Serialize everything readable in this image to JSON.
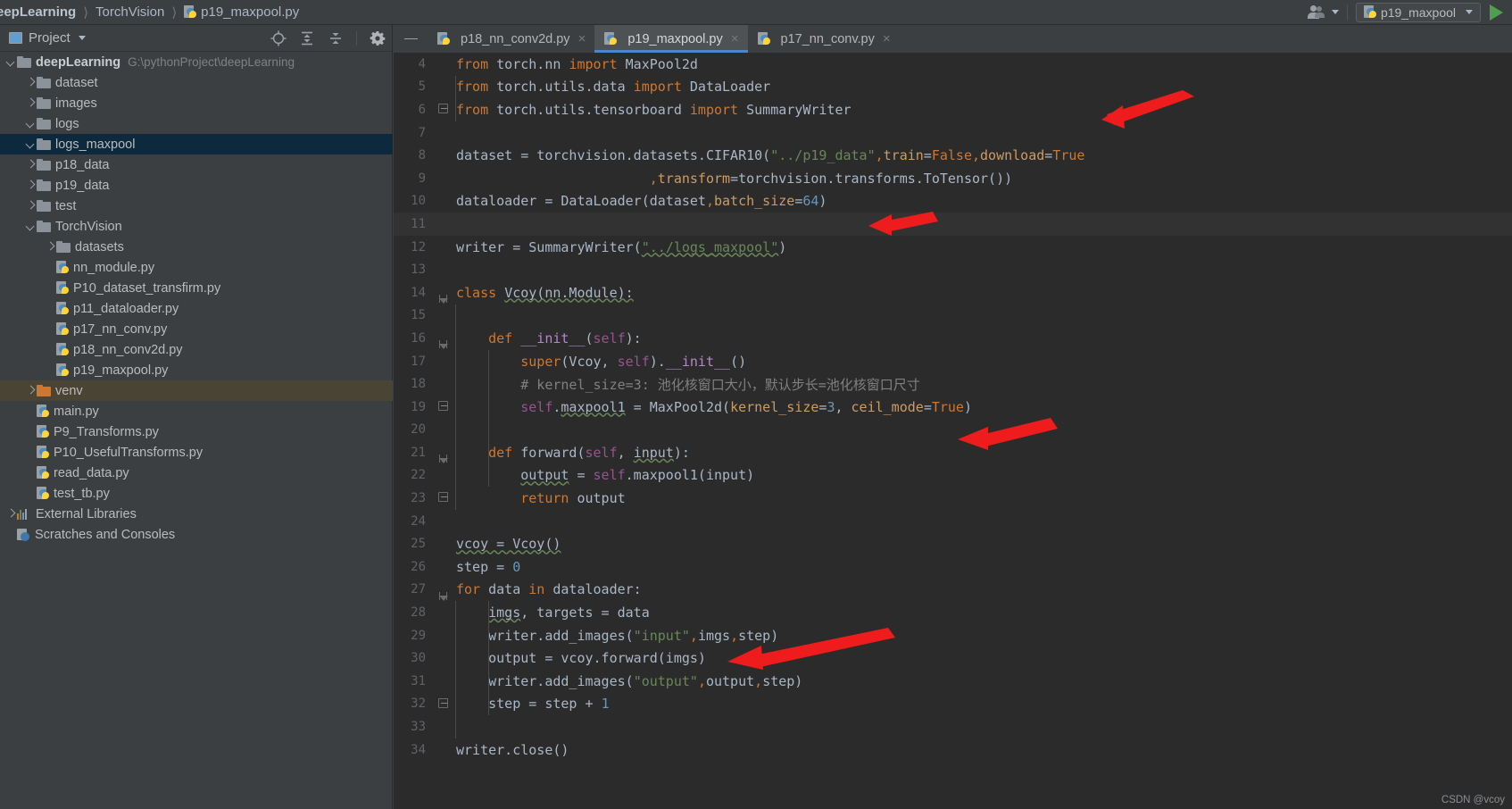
{
  "titlebar": {
    "breadcrumbs": [
      "eepLearning",
      "TorchVision",
      "p19_maxpool.py"
    ],
    "account_icon": "people-icon",
    "run_config": "p19_maxpool",
    "run_icon": "run-triangle-icon"
  },
  "project_panel": {
    "title": "Project",
    "tools": [
      "locate-target-icon",
      "expand-all-icon",
      "collapse-all-icon",
      "gear-icon",
      "minimize-icon"
    ],
    "tree": [
      {
        "label": "deepLearning",
        "path": "G:\\pythonProject\\deepLearning",
        "type": "folder",
        "state": "down",
        "indent": 0,
        "bold": true,
        "selected": false
      },
      {
        "label": "dataset",
        "type": "folder",
        "state": "right",
        "indent": 1,
        "selected": false
      },
      {
        "label": "images",
        "type": "folder",
        "state": "right",
        "indent": 1,
        "selected": false
      },
      {
        "label": "logs",
        "type": "folder",
        "state": "down",
        "indent": 1,
        "selected": false
      },
      {
        "label": "logs_maxpool",
        "type": "folder",
        "state": "down",
        "indent": 1,
        "selected": true
      },
      {
        "label": "p18_data",
        "type": "folder",
        "state": "right",
        "indent": 1,
        "selected": false
      },
      {
        "label": "p19_data",
        "type": "folder",
        "state": "right",
        "indent": 1,
        "selected": false
      },
      {
        "label": "test",
        "type": "folder",
        "state": "right",
        "indent": 1,
        "selected": false
      },
      {
        "label": "TorchVision",
        "type": "folder",
        "state": "down",
        "indent": 1,
        "selected": false
      },
      {
        "label": "datasets",
        "type": "folder",
        "state": "right",
        "indent": 2,
        "selected": false
      },
      {
        "label": "nn_module.py",
        "type": "py",
        "indent": 2,
        "selected": false
      },
      {
        "label": "P10_dataset_transfirm.py",
        "type": "py",
        "indent": 2,
        "selected": false
      },
      {
        "label": "p11_dataloader.py",
        "type": "py",
        "indent": 2,
        "selected": false
      },
      {
        "label": "p17_nn_conv.py",
        "type": "py",
        "indent": 2,
        "selected": false
      },
      {
        "label": "p18_nn_conv2d.py",
        "type": "py",
        "indent": 2,
        "selected": false
      },
      {
        "label": "p19_maxpool.py",
        "type": "py",
        "indent": 2,
        "selected": false
      },
      {
        "label": "venv",
        "type": "folder-orange",
        "state": "right",
        "indent": 1,
        "selected": "venv"
      },
      {
        "label": "main.py",
        "type": "py",
        "indent": 1,
        "selected": false
      },
      {
        "label": "P9_Transforms.py",
        "type": "py",
        "indent": 1,
        "selected": false
      },
      {
        "label": "P10_UsefulTransforms.py",
        "type": "py",
        "indent": 1,
        "selected": false
      },
      {
        "label": "read_data.py",
        "type": "py",
        "indent": 1,
        "selected": false
      },
      {
        "label": "test_tb.py",
        "type": "py",
        "indent": 1,
        "selected": false
      },
      {
        "label": "External Libraries",
        "type": "library",
        "state": "right",
        "indent": 0,
        "selected": false
      },
      {
        "label": "Scratches and Consoles",
        "type": "scratch",
        "indent": 0,
        "selected": false
      }
    ]
  },
  "editor": {
    "tabs": [
      {
        "label": "p18_nn_conv2d.py",
        "active": false,
        "close": "×"
      },
      {
        "label": "p19_maxpool.py",
        "active": true,
        "close": "×"
      },
      {
        "label": "p17_nn_conv.py",
        "active": false,
        "close": "×"
      }
    ],
    "first_line_number": 4,
    "current_line": 11,
    "lines": [
      {
        "n": 4,
        "text": "from torch.nn import MaxPool2d"
      },
      {
        "n": 5,
        "text": "from torch.utils.data import DataLoader"
      },
      {
        "n": 6,
        "text": "from torch.utils.tensorboard import SummaryWriter"
      },
      {
        "n": 7,
        "text": ""
      },
      {
        "n": 8,
        "text": "dataset = torchvision.datasets.CIFAR10(\"../p19_data\",train=False,download=True"
      },
      {
        "n": 9,
        "text": "                        ,transform=torchvision.transforms.ToTensor())"
      },
      {
        "n": 10,
        "text": "dataloader = DataLoader(dataset,batch_size=64)"
      },
      {
        "n": 11,
        "text": ""
      },
      {
        "n": 12,
        "text": "writer = SummaryWriter(\"../logs_maxpool\")"
      },
      {
        "n": 13,
        "text": ""
      },
      {
        "n": 14,
        "text": "class Vcoy(nn.Module):"
      },
      {
        "n": 15,
        "text": ""
      },
      {
        "n": 16,
        "text": "    def __init__(self):"
      },
      {
        "n": 17,
        "text": "        super(Vcoy, self).__init__()"
      },
      {
        "n": 18,
        "text": "        # kernel_size=3: 池化核窗口大小，默认步长=池化核窗口尺寸"
      },
      {
        "n": 19,
        "text": "        self.maxpool1 = MaxPool2d(kernel_size=3, ceil_mode=True)"
      },
      {
        "n": 20,
        "text": ""
      },
      {
        "n": 21,
        "text": "    def forward(self, input):"
      },
      {
        "n": 22,
        "text": "        output = self.maxpool1(input)"
      },
      {
        "n": 23,
        "text": "        return output"
      },
      {
        "n": 24,
        "text": ""
      },
      {
        "n": 25,
        "text": "vcoy = Vcoy()"
      },
      {
        "n": 26,
        "text": "step = 0"
      },
      {
        "n": 27,
        "text": "for data in dataloader:"
      },
      {
        "n": 28,
        "text": "    imgs, targets = data"
      },
      {
        "n": 29,
        "text": "    writer.add_images(\"input\",imgs,step)"
      },
      {
        "n": 30,
        "text": "    output = vcoy.forward(imgs)"
      },
      {
        "n": 31,
        "text": "    writer.add_images(\"output\",output,step)"
      },
      {
        "n": 32,
        "text": "    step = step + 1"
      },
      {
        "n": 33,
        "text": ""
      },
      {
        "n": 34,
        "text": "writer.close()"
      }
    ]
  },
  "annotations": {
    "arrow_color": "#ee1c1c",
    "count": 4
  },
  "watermark": "CSDN @vcoy",
  "colors": {
    "editor_bg": "#2b2b2b",
    "panel_bg": "#3c3f41",
    "selection_blue": "#0d293e",
    "accent_blue": "#4a88c7",
    "keyword_orange": "#cc7832",
    "string_green": "#6a8759",
    "number_blue": "#6897bb",
    "comment_gray": "#808080",
    "function_yellow": "#ffc66d"
  }
}
